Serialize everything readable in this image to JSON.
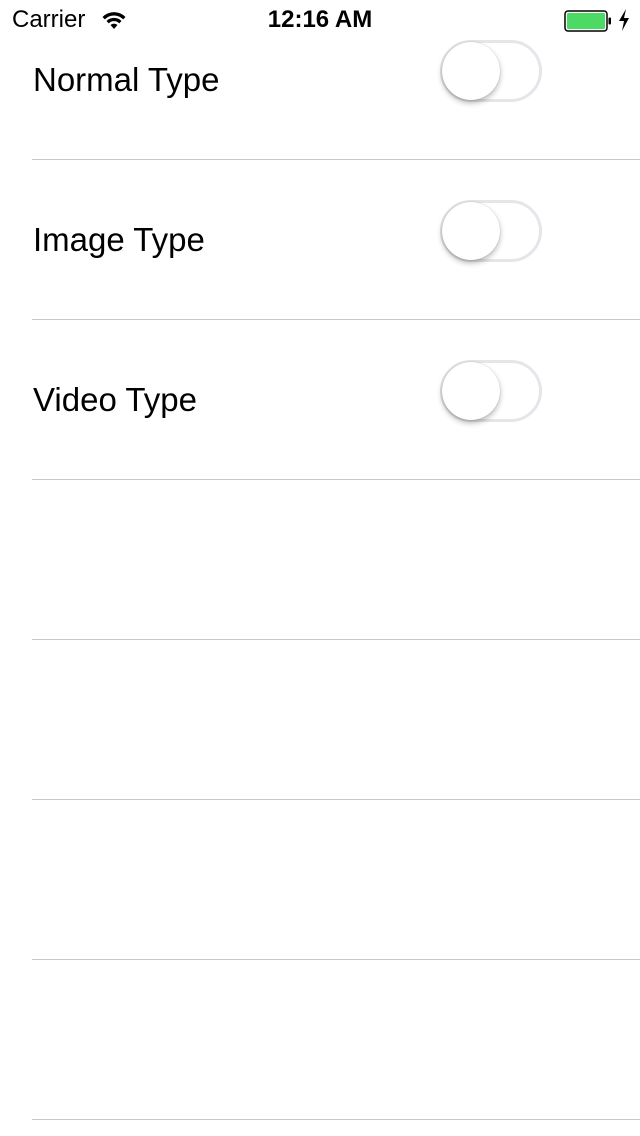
{
  "status_bar": {
    "carrier": "Carrier",
    "time": "12:16 AM",
    "battery_color": "#4cd964"
  },
  "rows": [
    {
      "label": "Normal Type",
      "switch_on": false
    },
    {
      "label": "Image Type",
      "switch_on": false
    },
    {
      "label": "Video Type",
      "switch_on": false
    }
  ],
  "colors": {
    "separator": "#c8c7cc",
    "switch_off_border": "#e5e5ea"
  }
}
